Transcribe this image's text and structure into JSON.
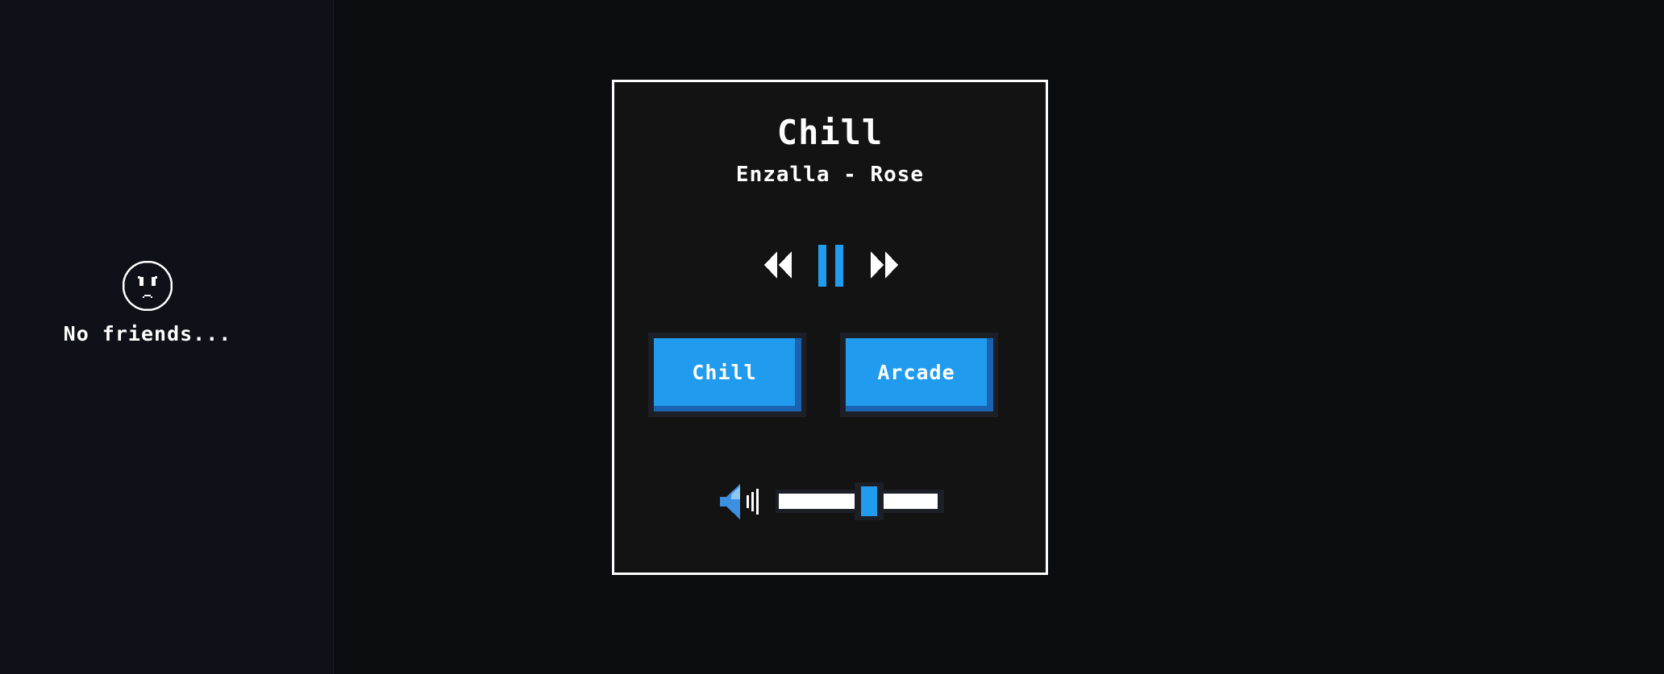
{
  "sidebar": {
    "empty_state": {
      "icon": "sad-face-icon",
      "text": "No friends..."
    }
  },
  "player": {
    "title": "Chill",
    "subtitle": "Enzalla - Rose",
    "controls": {
      "previous_icon": "rewind-icon",
      "pause_icon": "pause-icon",
      "next_icon": "fast-forward-icon"
    },
    "playlists": [
      {
        "label": "Chill"
      },
      {
        "label": "Arcade"
      }
    ],
    "volume": {
      "icon": "speaker-icon",
      "level_percent": 55
    }
  },
  "colors": {
    "background": "#0b0d11",
    "sidebar": "#0e1118",
    "panel": "#131313",
    "accent": "#219bed",
    "accent_shadow": "#1b62b2",
    "border": "#ffffff"
  }
}
